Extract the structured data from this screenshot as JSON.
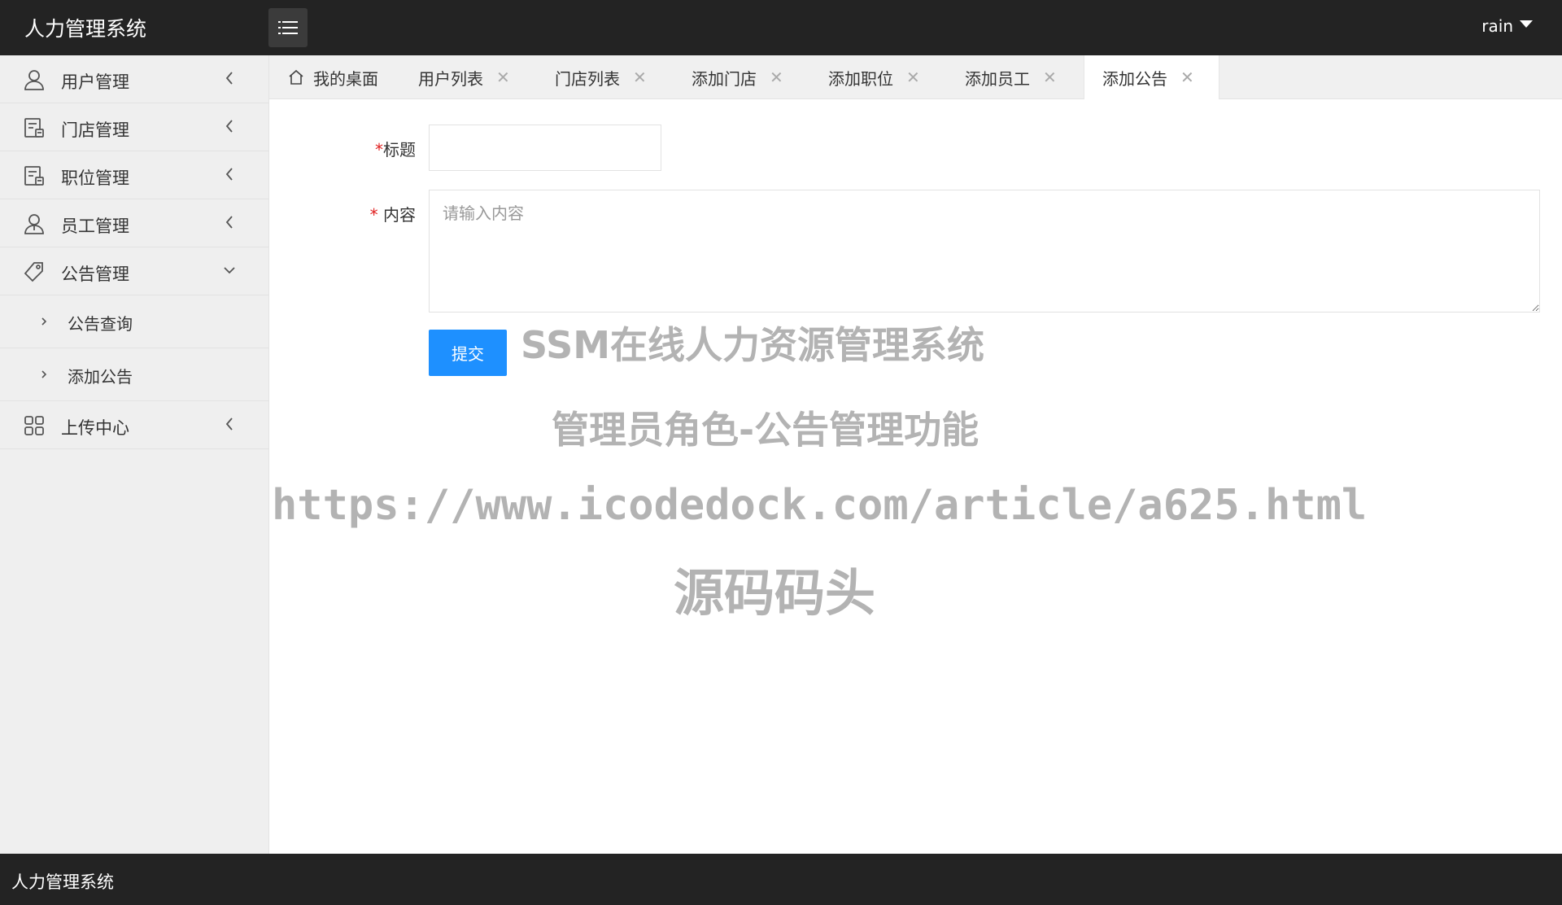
{
  "header": {
    "title": "人力管理系统",
    "user": "rain"
  },
  "sidebar": {
    "items": [
      {
        "label": "用户管理",
        "icon": "user-icon",
        "expanded": false
      },
      {
        "label": "门店管理",
        "icon": "store-icon",
        "expanded": false
      },
      {
        "label": "职位管理",
        "icon": "position-icon",
        "expanded": false
      },
      {
        "label": "员工管理",
        "icon": "employee-icon",
        "expanded": false
      },
      {
        "label": "公告管理",
        "icon": "tag-icon",
        "expanded": true,
        "children": [
          {
            "label": "公告查询"
          },
          {
            "label": "添加公告"
          }
        ]
      },
      {
        "label": "上传中心",
        "icon": "grid-icon",
        "expanded": false
      }
    ]
  },
  "tabs": [
    {
      "label": "我的桌面",
      "icon": "home-icon",
      "closable": false
    },
    {
      "label": "用户列表",
      "closable": true
    },
    {
      "label": "门店列表",
      "closable": true
    },
    {
      "label": "添加门店",
      "closable": true
    },
    {
      "label": "添加职位",
      "closable": true
    },
    {
      "label": "添加员工",
      "closable": true
    },
    {
      "label": "添加公告",
      "closable": true,
      "active": true
    }
  ],
  "tab_close_glyph": "✕",
  "form": {
    "required_mark": "*",
    "title_label": "标题",
    "title_value": "",
    "content_label": "内容",
    "content_placeholder": "请输入内容",
    "submit_label": "提交"
  },
  "watermark": {
    "line1": "SSM在线人力资源管理系统",
    "line2": "管理员角色-公告管理功能",
    "line3": "https://www.icodedock.com/article/a625.html",
    "line4": "源码码头"
  },
  "footer": {
    "text": "人力管理系统"
  },
  "colors": {
    "topbar": "#232323",
    "sidebar": "#efefef",
    "primary": "#1e90ff",
    "required": "#e02020"
  }
}
